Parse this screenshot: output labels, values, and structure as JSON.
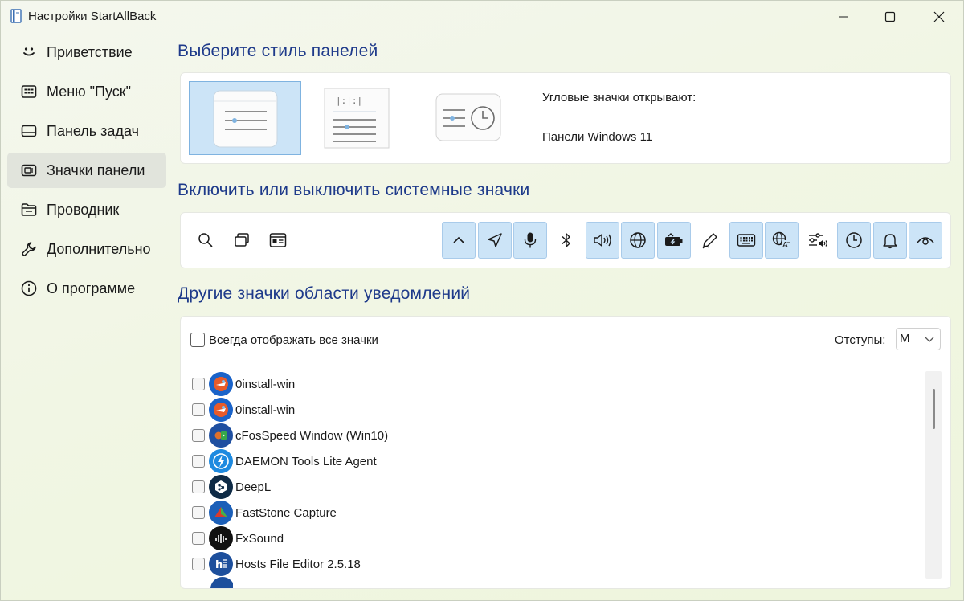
{
  "window": {
    "title": "Настройки StartAllBack"
  },
  "sidebar": {
    "items": [
      {
        "label": "Приветствие",
        "icon": "smile-icon"
      },
      {
        "label": "Меню \"Пуск\"",
        "icon": "start-menu-icon"
      },
      {
        "label": "Панель задач",
        "icon": "taskbar-icon"
      },
      {
        "label": "Значки панели",
        "icon": "tray-icons-icon",
        "active": true
      },
      {
        "label": "Проводник",
        "icon": "folder-icon"
      },
      {
        "label": "Дополнительно",
        "icon": "wrench-icon"
      },
      {
        "label": "О программе",
        "icon": "info-icon"
      }
    ]
  },
  "panel_style": {
    "heading": "Выберите стиль панелей",
    "corner_label": "Угловые значки открывают:",
    "corner_value": "Панели Windows 11",
    "selected_option": 0
  },
  "system_icons": {
    "heading": "Включить или выключить системные значки",
    "icons": [
      {
        "name": "search-icon",
        "on": false
      },
      {
        "name": "task-view-icon",
        "on": false
      },
      {
        "name": "widgets-icon",
        "on": false
      },
      {
        "name": "chevron-up-icon",
        "on": true
      },
      {
        "name": "location-icon",
        "on": true
      },
      {
        "name": "microphone-icon",
        "on": true
      },
      {
        "name": "bluetooth-icon",
        "on": false
      },
      {
        "name": "volume-icon",
        "on": true
      },
      {
        "name": "network-globe-icon",
        "on": true
      },
      {
        "name": "battery-icon",
        "on": true
      },
      {
        "name": "pen-icon",
        "on": false
      },
      {
        "name": "keyboard-icon",
        "on": true
      },
      {
        "name": "language-icon",
        "on": true
      },
      {
        "name": "audio-mixer-icon",
        "on": false
      },
      {
        "name": "clock-icon",
        "on": true
      },
      {
        "name": "notification-bell-icon",
        "on": true
      },
      {
        "name": "eye-icon",
        "on": true
      }
    ]
  },
  "other_icons": {
    "heading": "Другие значки области уведомлений",
    "always_show_label": "Всегда отображать все значки",
    "padding_label": "Отступы:",
    "padding_value": "M",
    "apps": [
      {
        "label": "0install-win",
        "icon": "zero-install-icon"
      },
      {
        "label": "0install-win",
        "icon": "zero-install-icon"
      },
      {
        "label": "cFosSpeed Window (Win10)",
        "icon": "cfosspeed-icon"
      },
      {
        "label": "DAEMON Tools Lite Agent",
        "icon": "daemon-tools-icon"
      },
      {
        "label": "DeepL",
        "icon": "deepl-icon"
      },
      {
        "label": "FastStone Capture",
        "icon": "faststone-icon"
      },
      {
        "label": "FxSound",
        "icon": "fxsound-icon"
      },
      {
        "label": "Hosts File Editor 2.5.18",
        "icon": "hosts-editor-icon"
      }
    ]
  },
  "colors": {
    "accent": "#1e3a8a",
    "selected_bg": "#cce4f7",
    "window_bg": "#f1f6e4"
  }
}
